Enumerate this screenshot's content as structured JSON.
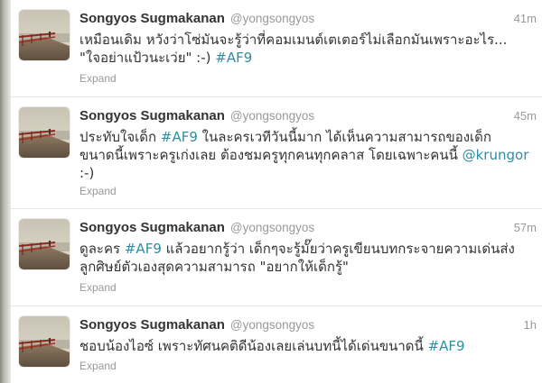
{
  "tweets": [
    {
      "fullname": "Songyos Sugmakanan",
      "username": "@yongsongyos",
      "time": "41m",
      "lines": [
        [
          {
            "t": "text",
            "v": "เหมือนเดิม หวังว่าโซ่มันจะรู้ว่าที่คอมเมนต์เตเตอร์ไม่เลือกมันเพราะอะไร..."
          }
        ],
        [
          {
            "t": "text",
            "v": "\"ใจอย่าแป้วนะเว่ย\" :-) "
          },
          {
            "t": "hashtag",
            "v": "#AF9"
          }
        ]
      ],
      "expand": "Expand"
    },
    {
      "fullname": "Songyos Sugmakanan",
      "username": "@yongsongyos",
      "time": "45m",
      "lines": [
        [
          {
            "t": "text",
            "v": "ประทับใจเด็ก "
          },
          {
            "t": "hashtag",
            "v": "#AF9"
          },
          {
            "t": "text",
            "v": " ในละครเวทีวันนี้มาก ได้เห็นความสามารถของเด็ก"
          }
        ],
        [
          {
            "t": "text",
            "v": "ขนาดนี้เพราะครูเก่งเลย ต้องชมครูทุกคนทุกคลาส โดยเฉพาะคนนี้ "
          },
          {
            "t": "mention",
            "v": "@krungor"
          }
        ],
        [
          {
            "t": "text",
            "v": ":-)"
          }
        ]
      ],
      "expand": "Expand"
    },
    {
      "fullname": "Songyos Sugmakanan",
      "username": "@yongsongyos",
      "time": "57m",
      "lines": [
        [
          {
            "t": "text",
            "v": "ดูละคร "
          },
          {
            "t": "hashtag",
            "v": "#AF9"
          },
          {
            "t": "text",
            "v": " แล้วอยากรู้ว่า เด็กๆจะรู้มั๊ยว่าครูเขียนบทกระจายความเด่นส่ง"
          }
        ],
        [
          {
            "t": "text",
            "v": "ลูกศิษย์ตัวเองสุดความสามารถ \"อยากให้เด็กรู้\""
          }
        ]
      ],
      "expand": "Expand"
    },
    {
      "fullname": "Songyos Sugmakanan",
      "username": "@yongsongyos",
      "time": "1h",
      "lines": [
        [
          {
            "t": "text",
            "v": "ชอบน้องไอซ์ เพราะทัศนคติดีน้องเลยเล่นบทนี้ได้เด่นขนาดนี้ "
          },
          {
            "t": "hashtag",
            "v": "#AF9"
          }
        ]
      ],
      "expand": "Expand"
    }
  ],
  "colors": {
    "link": "#2a8fa1",
    "meta": "#999999",
    "text": "#333333"
  },
  "icons": {
    "avatar": "pier-photo-avatar"
  }
}
